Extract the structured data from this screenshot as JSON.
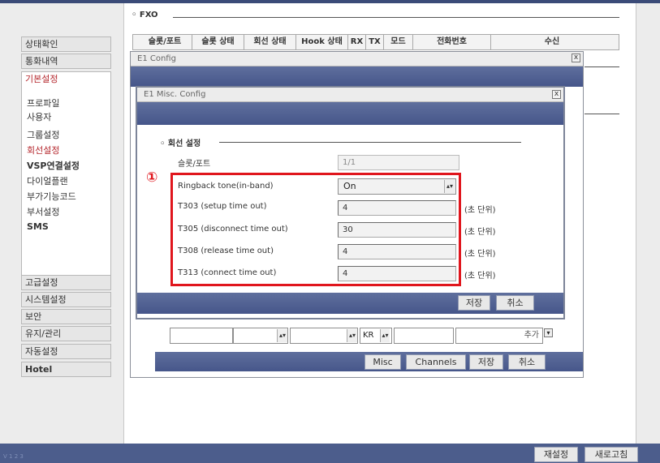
{
  "sidebar": {
    "sections": [
      "상태확인",
      "통화내역",
      "기본설정"
    ],
    "basic_items": [
      "프로파일",
      "사용자",
      "그룹설정",
      "회선설정",
      "VSP연결설정",
      "다이얼플랜",
      "부가기능코드",
      "부서설정",
      "SMS"
    ],
    "bottom_sections": [
      "고급설정",
      "시스템설정",
      "보안",
      "유지/관리",
      "자동설정",
      "Hotel"
    ]
  },
  "fxo": {
    "title": "FXO",
    "columns": [
      "슬롯/포트",
      "슬롯 상태",
      "회선 상태",
      "Hook 상태",
      "RX",
      "TX",
      "모드",
      "전화번호",
      "수신"
    ]
  },
  "e1_config": {
    "title": "E1 Config",
    "close": "x",
    "country_select": "KR",
    "add_button": "추가",
    "buttons": [
      "Misc",
      "Channels",
      "저장",
      "취소"
    ]
  },
  "misc": {
    "title": "E1 Misc. Config",
    "close": "x",
    "section_title": "회선 설정",
    "slot_port_label": "슬롯/포트",
    "slot_port_value": "1/1",
    "annotation_marker": "①",
    "ringback": {
      "label": "Ringback tone(in-band)",
      "value": "On"
    },
    "timers": [
      {
        "label": "T303 (setup time out)",
        "value": "4",
        "unit": "(초 단위)"
      },
      {
        "label": "T305 (disconnect time out)",
        "value": "30",
        "unit": "(초 단위)"
      },
      {
        "label": "T308 (release time out)",
        "value": "4",
        "unit": "(초 단위)"
      },
      {
        "label": "T313 (connect time out)",
        "value": "4",
        "unit": "(초 단위)"
      }
    ],
    "save_label": "저장",
    "cancel_label": "취소"
  },
  "footer": {
    "version": "V 1 2 3",
    "save_settings": "재설정",
    "refresh": "새로고침"
  },
  "colors": {
    "navy": "#4c5d8c",
    "active_menu_text": "#b5282e",
    "highlight_border": "#e0161d"
  }
}
